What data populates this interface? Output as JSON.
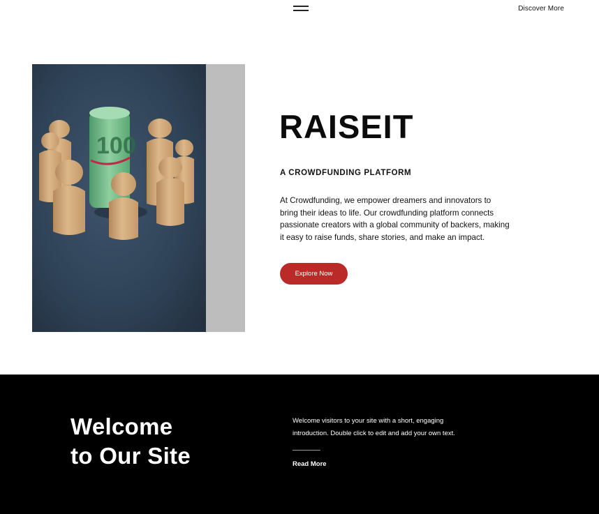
{
  "header": {
    "menu_icon": "hamburger-menu-icon",
    "discover_label": "Discover More"
  },
  "hero": {
    "image_description": "wooden-figures-around-money-roll",
    "title": "RAISEIT",
    "tagline": "A CROWDFUNDING PLATFORM",
    "description": "At Crowdfunding, we empower dreamers and innovators to bring their ideas to life. Our crowdfunding platform connects passionate creators with a global community of backers, making it easy to raise funds, share stories, and make an impact.",
    "button_label": "Explore Now",
    "button_color": "#b92a29",
    "banknote_text": "100"
  },
  "welcome": {
    "title_line1": "Welcome",
    "title_line2": "to Our Site",
    "text": "Welcome visitors to your site with a short, engaging introduction. Double click to edit and add your own text.",
    "read_more_label": "Read More",
    "background": "#000000"
  }
}
